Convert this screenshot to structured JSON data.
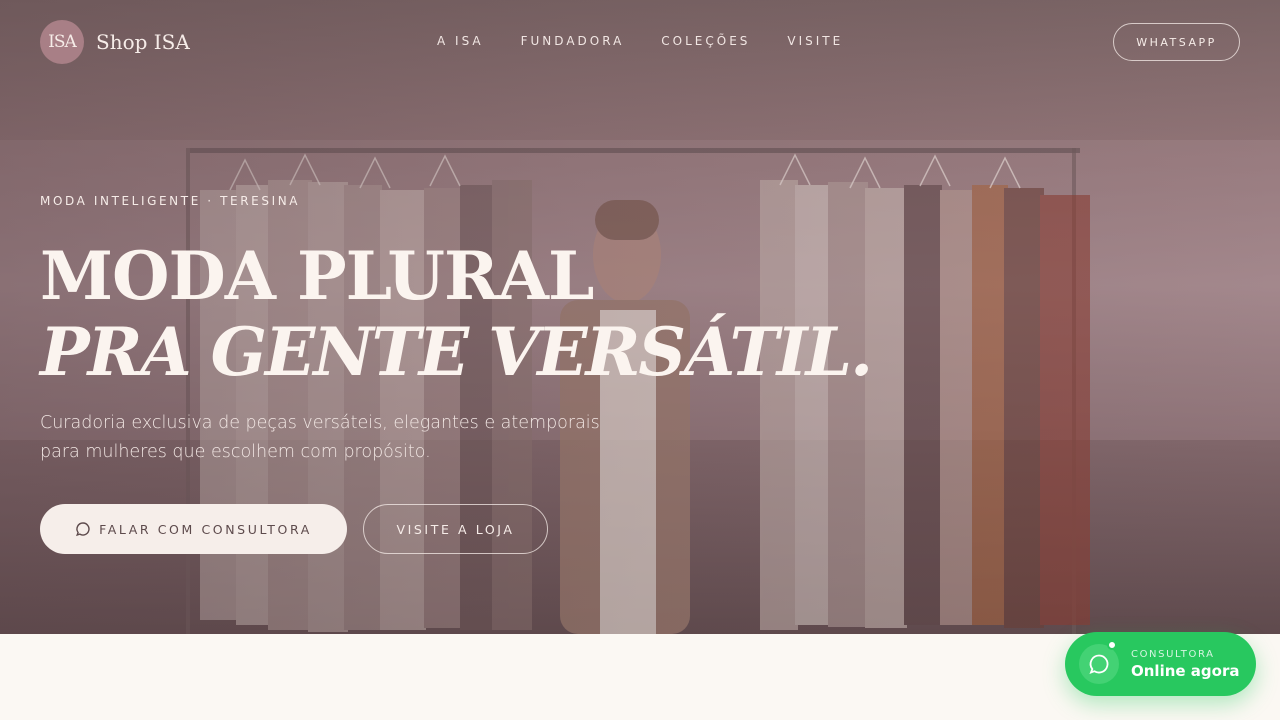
{
  "header": {
    "logo_mark": "ISA",
    "brand_name": "Shop ISA",
    "nav": [
      {
        "label": "A ISA"
      },
      {
        "label": "FUNDADORA"
      },
      {
        "label": "COLEÇÕES"
      },
      {
        "label": "VISITE"
      }
    ],
    "cta_label": "WHATSAPP"
  },
  "hero": {
    "eyebrow": "MODA INTELIGENTE · TERESINA",
    "title_line1": "MODA PLURAL",
    "title_line2": "PRA GENTE VERSÁTIL.",
    "subtitle": "Curadoria exclusiva de peças versáteis, elegantes e atemporais para mulheres que escolhem com propósito.",
    "primary_button": "FALAR COM CONSULTORA",
    "secondary_button": "VISITE A LOJA"
  },
  "float_chat": {
    "label": "CONSULTORA",
    "status": "Online agora"
  },
  "colors": {
    "hero_overlay": "#8e7276",
    "accent_green": "#28c85f",
    "cream": "#fbf8f3",
    "logo_badge": "#a87f86"
  },
  "icons": {
    "chat": "chat-bubble-icon"
  }
}
